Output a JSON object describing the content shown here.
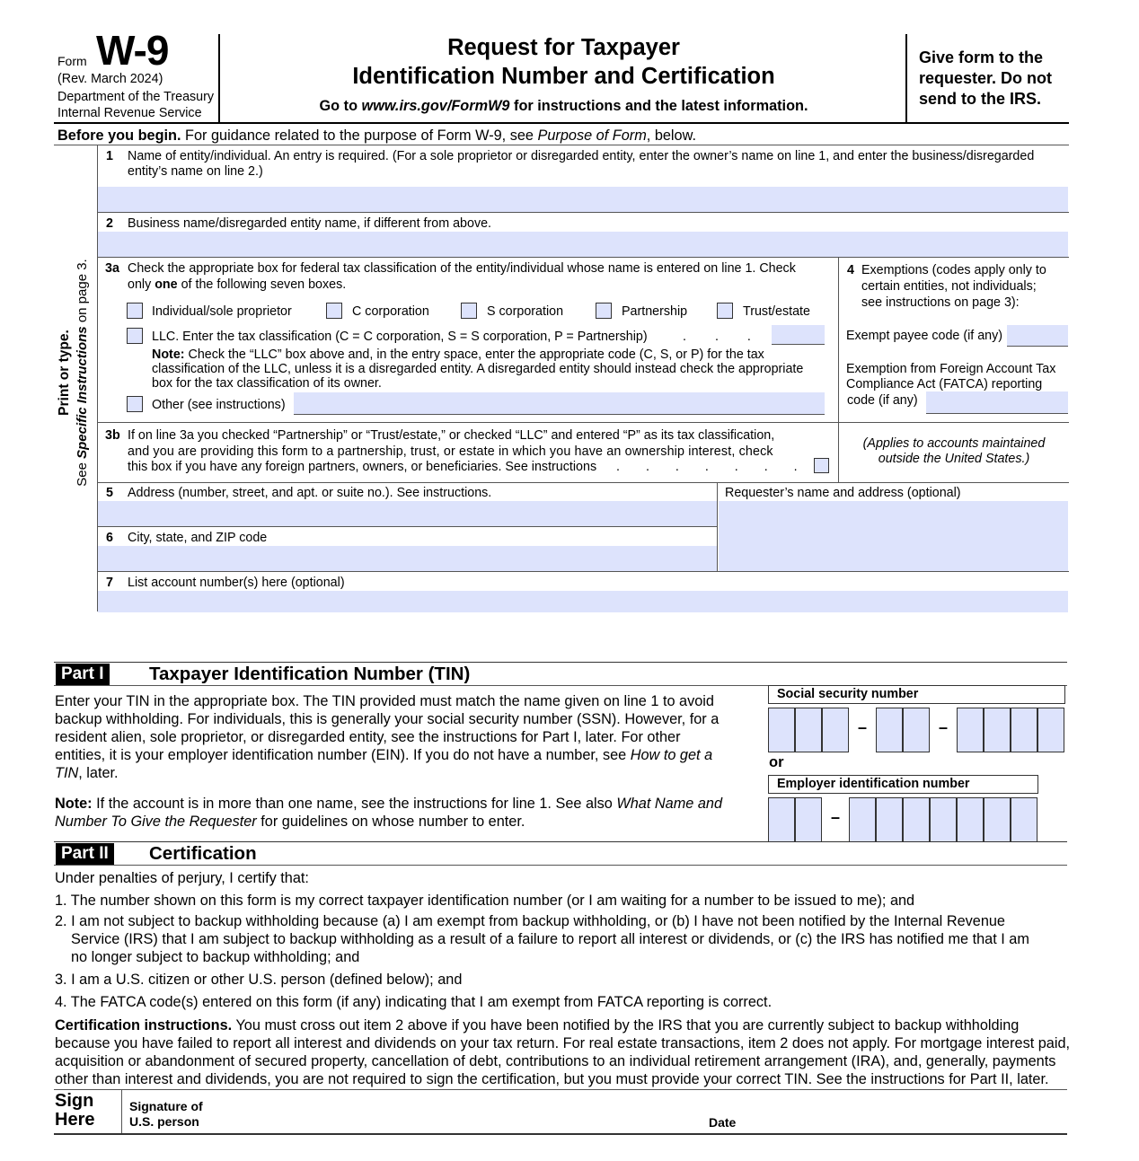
{
  "header": {
    "form_word": "Form",
    "form_number": "W-9",
    "revision": "(Rev. March 2024)",
    "department_line1": "Department of the Treasury",
    "department_line2": "Internal Revenue Service",
    "title_line1": "Request for Taxpayer",
    "title_line2": "Identification Number and Certification",
    "goto_prefix": "Go to ",
    "goto_url": "www.irs.gov/FormW9",
    "goto_suffix": " for instructions and the latest information.",
    "give_form_notice": "Give form to the requester. Do not send to the IRS."
  },
  "before_begin": {
    "bold": "Before you begin.",
    "text": " For guidance related to the purpose of Form W-9, see ",
    "italic": "Purpose of Form",
    "suffix": ", below."
  },
  "sidebar": {
    "line1": "Print or type.",
    "line2_prefix": "See ",
    "line2_italic": "Specific Instructions",
    "line2_suffix": " on page 3."
  },
  "lines": {
    "line1": {
      "num": "1",
      "label": "Name of entity/individual. An entry is required. (For a sole proprietor or disregarded entity, enter the owner’s name on line 1, and enter the business/disregarded",
      "label2": "entity’s name on line 2.)",
      "value": ""
    },
    "line2": {
      "num": "2",
      "label": "Business name/disregarded entity name, if different from above.",
      "value": ""
    },
    "line3a": {
      "num": "3a",
      "label": "Check the appropriate box for federal tax classification of the entity/individual whose name is entered on line 1. Check",
      "label2_prefix": "only ",
      "label2_bold": "one",
      "label2_suffix": " of the following seven boxes.",
      "options": [
        {
          "label": "Individual/sole proprietor",
          "checked": false
        },
        {
          "label": "C corporation",
          "checked": false
        },
        {
          "label": "S corporation",
          "checked": false
        },
        {
          "label": "Partnership",
          "checked": false
        },
        {
          "label": "Trust/estate",
          "checked": false
        }
      ],
      "llc_label": "LLC. Enter the tax classification (C = C corporation, S = S corporation, P = Partnership)",
      "llc_dots": ". . . . .",
      "llc_value": "",
      "note_bold": "Note:",
      "note_line1": " Check the “LLC” box above and, in the entry space, enter the appropriate code (C, S, or P) for the tax",
      "note_line2": "classification of the LLC, unless it is a disregarded entity. A disregarded entity should instead check the appropriate",
      "note_line3": "box for the tax classification of its owner.",
      "other_label": "Other (see instructions)",
      "other_value": ""
    },
    "line3b": {
      "num": "3b",
      "line1": "If on line 3a you checked “Partnership” or “Trust/estate,” or checked “LLC” and entered “P” as its tax classification,",
      "line2": "and you are providing this form to a partnership, trust, or estate in which you have an ownership interest, check",
      "line3": "this box if you have any foreign partners, owners, or beneficiaries. See instructions",
      "dots": ". . . . . . . . . . .",
      "checked": false
    },
    "line4": {
      "num": "4",
      "line1": "Exemptions (codes apply only to",
      "line2": "certain entities, not individuals;",
      "line3": "see instructions on page 3):",
      "exempt_payee_label": "Exempt payee code (if any)",
      "exempt_payee_value": "",
      "fatca_line1": "Exemption from Foreign Account Tax",
      "fatca_line2": "Compliance Act (FATCA) reporting",
      "fatca_line3": "code (if any)",
      "fatca_value": "",
      "applies_line1": "(Applies to accounts maintained",
      "applies_line2": "outside the United States.)"
    },
    "line5": {
      "num": "5",
      "label": "Address (number, street, and apt. or suite no.). See instructions.",
      "value": ""
    },
    "requester": {
      "label": "Requester’s name and address (optional)",
      "value": ""
    },
    "line6": {
      "num": "6",
      "label": "City, state, and ZIP code",
      "value": ""
    },
    "line7": {
      "num": "7",
      "label": "List account number(s) here (optional)",
      "value": ""
    }
  },
  "part1": {
    "badge": "Part I",
    "title": "Taxpayer Identification Number (TIN)",
    "para_lines": [
      "Enter your TIN in the appropriate box. The TIN provided must match the name given on line 1 to avoid",
      "backup withholding. For individuals, this is generally your social security number (SSN). However, for a",
      "resident alien, sole proprietor, or disregarded entity, see the instructions for Part I, later. For other",
      "entities, it is your employer identification number (EIN). If you do not have a number, see "
    ],
    "para_italic": "How to get a",
    "para_last_italic": "TIN",
    "para_last_suffix": ", later.",
    "note_bold": "Note:",
    "note_line1": " If the account is in more than one name, see the instructions for line 1. See also ",
    "note_italic1": "What Name and",
    "note_italic2": "Number To Give the Requester",
    "note_line2_suffix": " for guidelines on whose number to enter.",
    "ssn_label": "Social security number",
    "or_label": "or",
    "ein_label": "Employer identification number",
    "ssn_digits": [
      "",
      "",
      "",
      "",
      "",
      "",
      "",
      "",
      ""
    ],
    "ein_digits": [
      "",
      "",
      "",
      "",
      "",
      "",
      "",
      "",
      ""
    ],
    "dash": "–"
  },
  "part2": {
    "badge": "Part II",
    "title": "Certification",
    "intro": "Under penalties of perjury, I certify that:",
    "item1": "1. The number shown on this form is my correct taxpayer identification number (or I am waiting for a number to be issued to me); and",
    "item2_line1": "2. I am not subject to backup withholding because (a) I am exempt from backup withholding, or (b) I have not been notified by the Internal Revenue",
    "item2_line2": "Service (IRS) that I am subject to backup withholding as a result of a failure to report all interest or dividends, or (c) the IRS has notified me that I am",
    "item2_line3": "no longer subject to backup withholding; and",
    "item3": "3. I am a U.S. citizen or other U.S. person (defined below); and",
    "item4": "4. The FATCA code(s) entered on this form (if any) indicating that I am exempt from FATCA reporting is correct.",
    "cert_bold": "Certification instructions.",
    "cert_line1": " You must cross out item 2 above if you have been notified by the IRS that you are currently subject to backup withholding",
    "cert_line2": "because you have failed to report all interest and dividends on your tax return. For real estate transactions, item 2 does not apply. For mortgage interest paid,",
    "cert_line3": "acquisition or abandonment of secured property, cancellation of debt, contributions to an individual retirement arrangement (IRA), and, generally, payments",
    "cert_line4": "other than interest and dividends, you are not required to sign the certification, but you must provide your correct TIN. See the instructions for Part II, later."
  },
  "sign": {
    "sign_line1": "Sign",
    "sign_line2": "Here",
    "signature_line1": "Signature of",
    "signature_line2": "U.S. person",
    "date_label": "Date",
    "signature_value": "",
    "date_value": ""
  }
}
